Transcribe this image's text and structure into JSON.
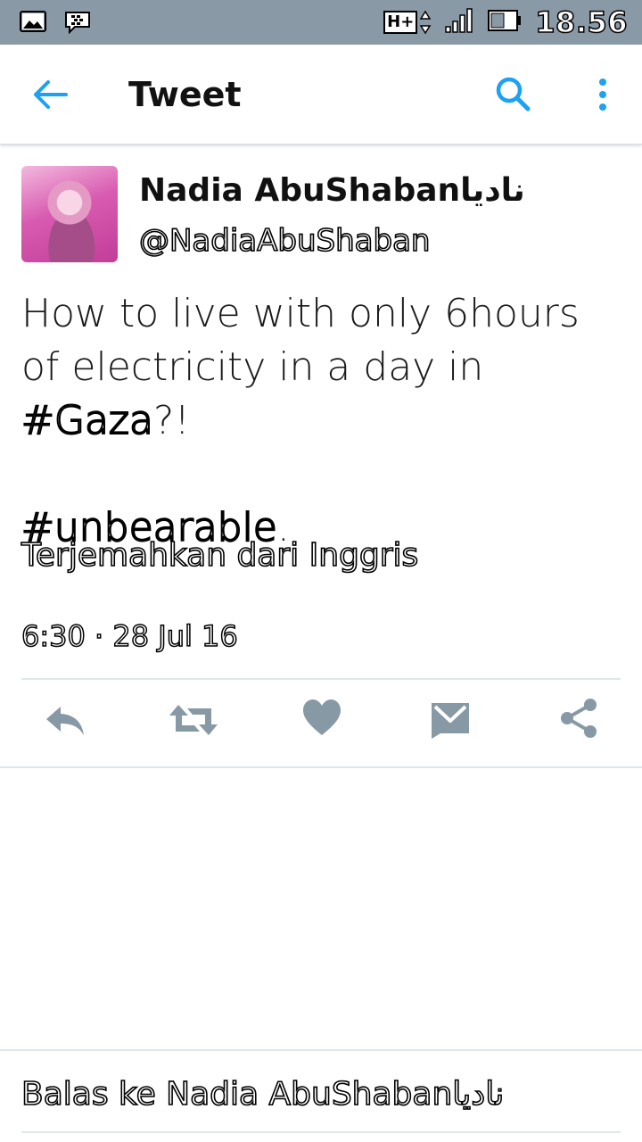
{
  "status_bar": {
    "network": "H+",
    "time": "18.56"
  },
  "app_bar": {
    "title": "Tweet"
  },
  "tweet": {
    "author_name": "Nadia AbuShabanناديا",
    "author_handle": "@NadiaAbuShaban",
    "text_part1": "How to live with only 6hours of electricity in a day in ",
    "hashtag1": "#Gaza",
    "text_part2": "?!",
    "hashtag2": "#unbearable",
    "text_part3": ".",
    "translate_label": "Terjemahkan dari Inggris",
    "timestamp": "6:30 · 28 Jul 16"
  },
  "reply_prompt": "Balas ke Nadia AbuShabanناديا",
  "colors": {
    "accent": "#1da1f2",
    "action_gray": "#8899a6",
    "status_bar_bg": "#8a99a6"
  }
}
